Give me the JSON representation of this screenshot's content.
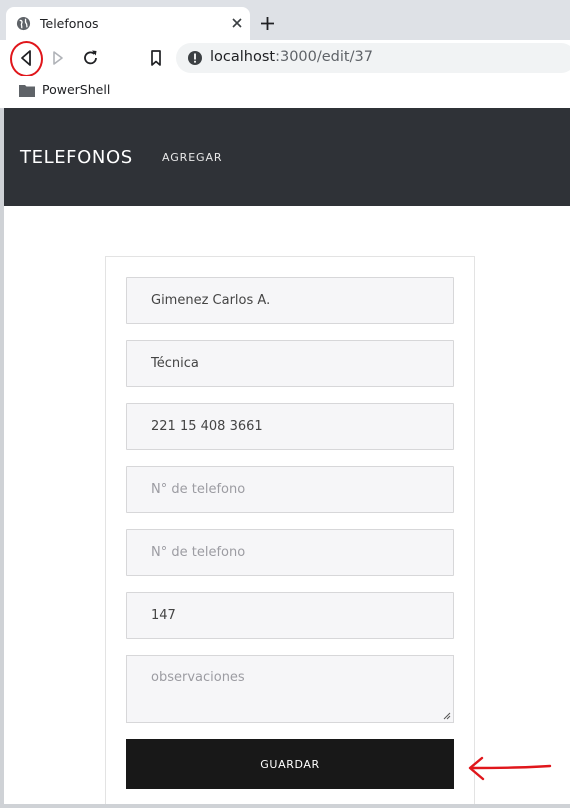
{
  "browser": {
    "tab_title": "Telefonos",
    "url_host": "localhost",
    "url_path": ":3000/edit/37",
    "bookmark_folder": "PowerShell"
  },
  "navbar": {
    "brand": "TELEFONOS",
    "link_add": "AGREGAR"
  },
  "form": {
    "fields": [
      {
        "value": "Gimenez Carlos A.",
        "placeholder": ""
      },
      {
        "value": "Técnica",
        "placeholder": ""
      },
      {
        "value": "221 15 408 3661",
        "placeholder": ""
      },
      {
        "value": "",
        "placeholder": "N° de telefono"
      },
      {
        "value": "",
        "placeholder": "N° de telefono"
      },
      {
        "value": "147",
        "placeholder": ""
      }
    ],
    "observations_placeholder": "observaciones",
    "save_label": "GUARDAR"
  },
  "annotations": {
    "highlight_color": "#e0161b"
  },
  "icons": [
    "globe-icon",
    "close-icon",
    "plus-icon",
    "back-arrow-icon",
    "forward-arrow-icon",
    "reload-icon",
    "bookmark-icon",
    "info-icon",
    "folder-icon",
    "resize-grip-icon",
    "red-arrow-icon"
  ]
}
